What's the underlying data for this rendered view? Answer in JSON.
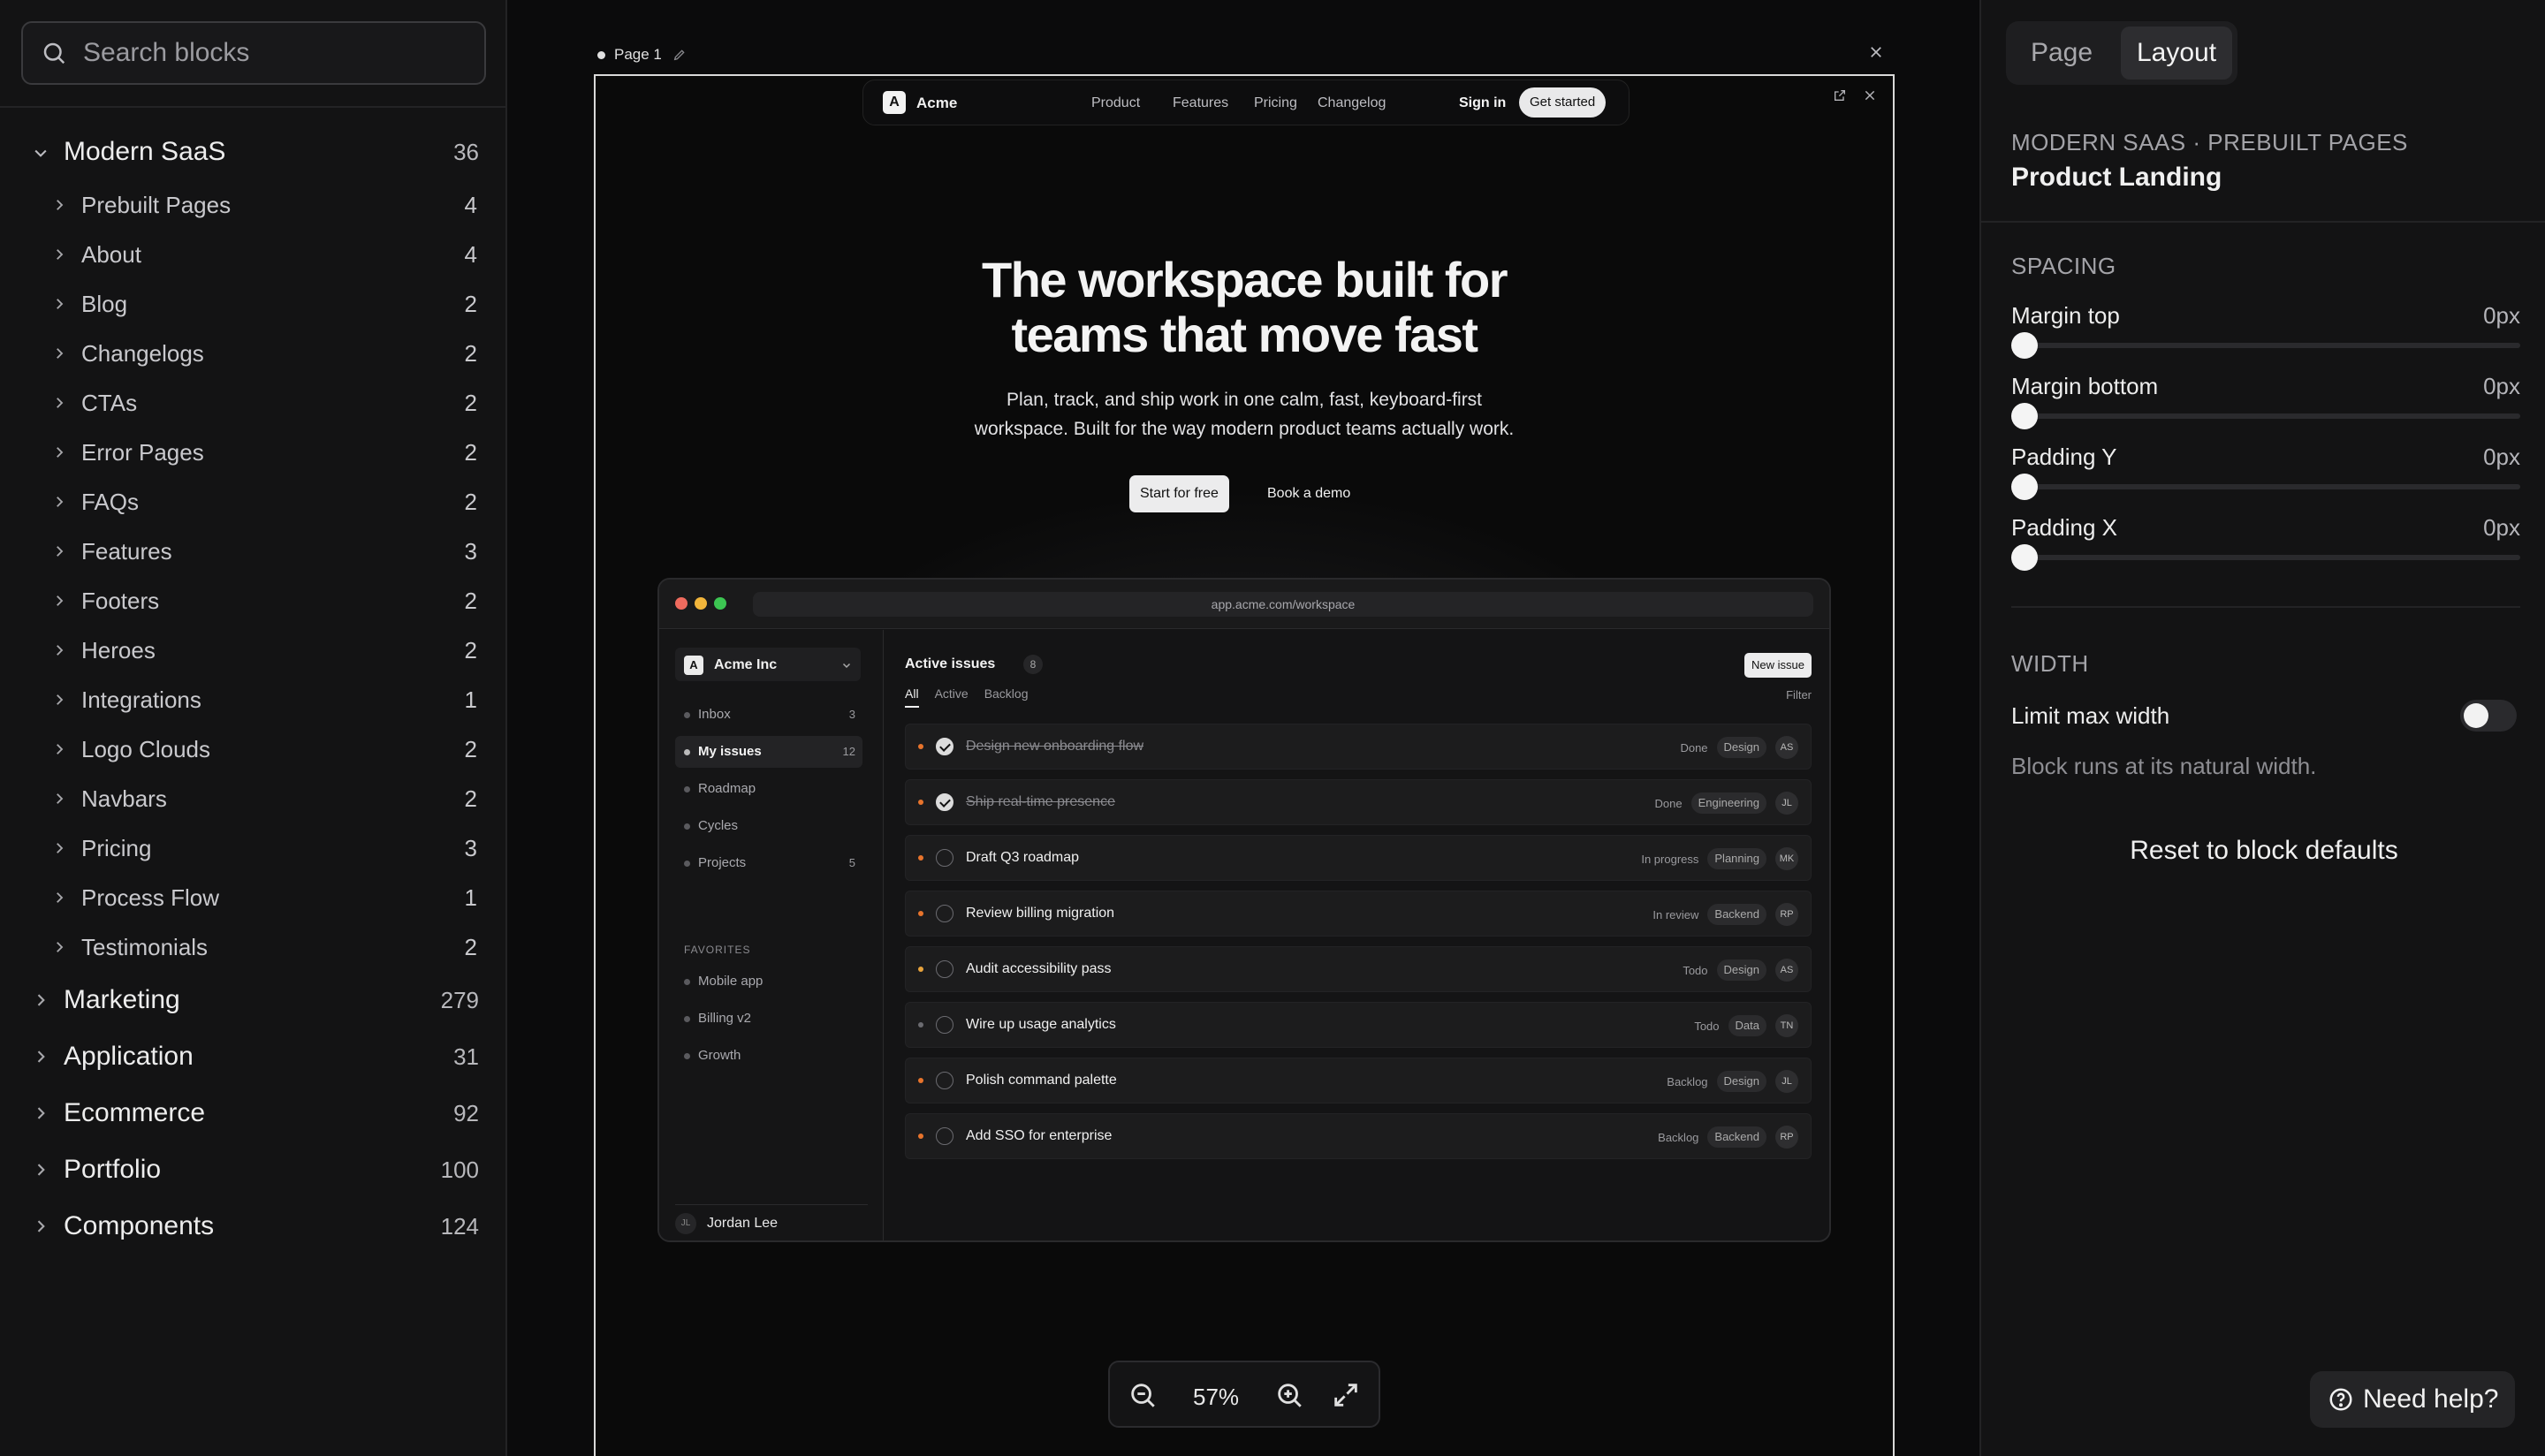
{
  "search": {
    "placeholder": "Search blocks"
  },
  "tree": {
    "modern_saas": {
      "label": "Modern SaaS",
      "count": "36"
    },
    "subs": [
      {
        "label": "Prebuilt Pages",
        "count": "4"
      },
      {
        "label": "About",
        "count": "4"
      },
      {
        "label": "Blog",
        "count": "2"
      },
      {
        "label": "Changelogs",
        "count": "2"
      },
      {
        "label": "CTAs",
        "count": "2"
      },
      {
        "label": "Error Pages",
        "count": "2"
      },
      {
        "label": "FAQs",
        "count": "2"
      },
      {
        "label": "Features",
        "count": "3"
      },
      {
        "label": "Footers",
        "count": "2"
      },
      {
        "label": "Heroes",
        "count": "2"
      },
      {
        "label": "Integrations",
        "count": "1"
      },
      {
        "label": "Logo Clouds",
        "count": "2"
      },
      {
        "label": "Navbars",
        "count": "2"
      },
      {
        "label": "Pricing",
        "count": "3"
      },
      {
        "label": "Process Flow",
        "count": "1"
      },
      {
        "label": "Testimonials",
        "count": "2"
      }
    ],
    "categories": [
      {
        "label": "Marketing",
        "count": "279"
      },
      {
        "label": "Application",
        "count": "31"
      },
      {
        "label": "Ecommerce",
        "count": "92"
      },
      {
        "label": "Portfolio",
        "count": "100"
      },
      {
        "label": "Components",
        "count": "124"
      }
    ]
  },
  "canvas": {
    "page_label": "Page 1",
    "zoom": "57%"
  },
  "preview": {
    "nav": {
      "logo": "A",
      "brand": "Acme",
      "links": [
        "Product",
        "Features",
        "Pricing",
        "Changelog"
      ],
      "signin": "Sign in",
      "cta": "Get started"
    },
    "hero": {
      "title_line1": "The workspace built for",
      "title_line2": "teams that move fast",
      "sub_line1": "Plan, track, and ship work in one calm, fast, keyboard-first",
      "sub_line2": "workspace. Built for the way modern product teams actually work.",
      "primary": "Start for free",
      "secondary": "Book a demo"
    },
    "app": {
      "url": "app.acme.com/workspace",
      "workspace_logo": "A",
      "workspace": "Acme Inc",
      "nav": [
        {
          "label": "Inbox",
          "count": "3"
        },
        {
          "label": "My issues",
          "count": "12"
        },
        {
          "label": "Roadmap",
          "count": ""
        },
        {
          "label": "Cycles",
          "count": ""
        },
        {
          "label": "Projects",
          "count": "5"
        }
      ],
      "favorites_label": "FAVORITES",
      "favorites": [
        "Mobile app",
        "Billing v2",
        "Growth"
      ],
      "user_initials": "JL",
      "user": "Jordan Lee",
      "list_title": "Active issues",
      "list_count": "8",
      "new_issue": "New issue",
      "tabs": [
        "All",
        "Active",
        "Backlog"
      ],
      "filter": "Filter",
      "issues": [
        {
          "title": "Design new onboarding flow",
          "status": "Done",
          "tag": "Design",
          "assignee": "AS",
          "done": true,
          "priority": "#e8742c"
        },
        {
          "title": "Ship real-time presence",
          "status": "Done",
          "tag": "Engineering",
          "assignee": "JL",
          "done": true,
          "priority": "#e8742c"
        },
        {
          "title": "Draft Q3 roadmap",
          "status": "In progress",
          "tag": "Planning",
          "assignee": "MK",
          "done": false,
          "priority": "#e8742c"
        },
        {
          "title": "Review billing migration",
          "status": "In review",
          "tag": "Backend",
          "assignee": "RP",
          "done": false,
          "priority": "#e8742c"
        },
        {
          "title": "Audit accessibility pass",
          "status": "Todo",
          "tag": "Design",
          "assignee": "AS",
          "done": false,
          "priority": "#e8a33c"
        },
        {
          "title": "Wire up usage analytics",
          "status": "Todo",
          "tag": "Data",
          "assignee": "TN",
          "done": false,
          "priority": "#6b6b70"
        },
        {
          "title": "Polish command palette",
          "status": "Backlog",
          "tag": "Design",
          "assignee": "JL",
          "done": false,
          "priority": "#e8742c"
        },
        {
          "title": "Add SSO for enterprise",
          "status": "Backlog",
          "tag": "Backend",
          "assignee": "RP",
          "done": false,
          "priority": "#e8742c"
        }
      ]
    }
  },
  "panel": {
    "tabs": {
      "page": "Page",
      "layout": "Layout"
    },
    "breadcrumb": "MODERN SAAS · PREBUILT PAGES",
    "title": "Product Landing",
    "spacing_label": "SPACING",
    "sliders": [
      {
        "label": "Margin top",
        "value": "0px"
      },
      {
        "label": "Margin bottom",
        "value": "0px"
      },
      {
        "label": "Padding Y",
        "value": "0px"
      },
      {
        "label": "Padding X",
        "value": "0px"
      }
    ],
    "width_label": "WIDTH",
    "limit_label": "Limit max width",
    "limit_on": false,
    "note": "Block runs at its natural width.",
    "reset": "Reset to block defaults",
    "help": "Need help?"
  },
  "colors": {
    "traffic_red": "#ef6b5e",
    "traffic_yellow": "#f2b53b",
    "traffic_green": "#3cc552"
  }
}
